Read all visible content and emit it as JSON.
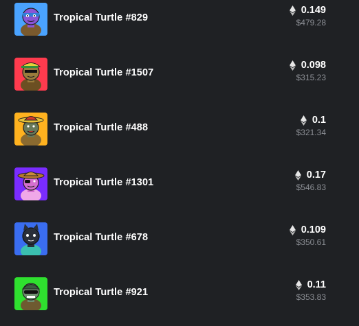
{
  "items": [
    {
      "name": "Tropical Turtle #829",
      "eth": "0.149",
      "usd": "$479.28",
      "icon": "turtle-avatar-icon",
      "bg": "#4aa3ff",
      "skin": "#8a55d6",
      "hat": "#2f7dd6"
    },
    {
      "name": "Tropical Turtle #1507",
      "eth": "0.098",
      "usd": "$315.23",
      "icon": "turtle-avatar-icon",
      "bg": "#ff3b4e",
      "skin": "#9a7c3c",
      "hat": "#e4d23a"
    },
    {
      "name": "Tropical Turtle #488",
      "eth": "0.1",
      "usd": "$321.34",
      "icon": "turtle-avatar-icon",
      "bg": "#ffb21f",
      "skin": "#6a7a5a",
      "hat": "#e8c33a"
    },
    {
      "name": "Tropical Turtle #1301",
      "eth": "0.17",
      "usd": "$546.83",
      "icon": "turtle-avatar-icon",
      "bg": "#7a2cff",
      "skin": "#d56fd0",
      "hat": "#b8792e"
    },
    {
      "name": "Tropical Turtle #678",
      "eth": "0.109",
      "usd": "$350.61",
      "icon": "turtle-avatar-icon",
      "bg": "#3a6df0",
      "skin": "#2a2f3a",
      "hat": "#2a2f3a"
    },
    {
      "name": "Tropical Turtle #921",
      "eth": "0.11",
      "usd": "$353.83",
      "icon": "turtle-avatar-icon",
      "bg": "#2fe02f",
      "skin": "#6e8f70",
      "hat": "#3b5a40"
    }
  ]
}
